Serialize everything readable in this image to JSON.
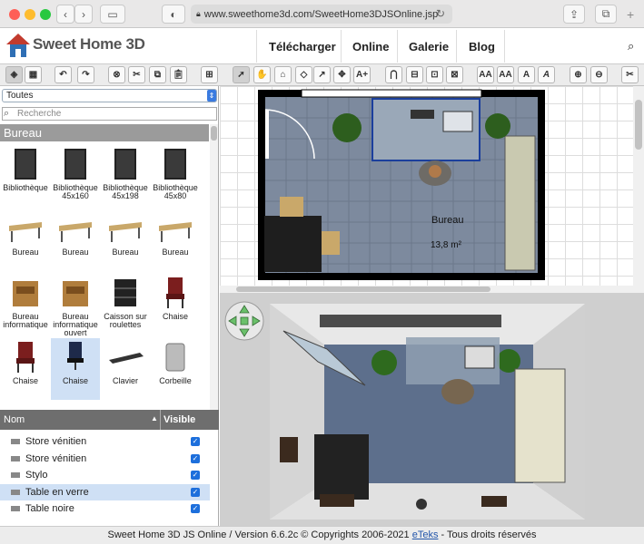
{
  "browser": {
    "url": "www.sweethome3d.com/SweetHome3DJSOnline.jsp"
  },
  "site": {
    "logo": "Sweet Home 3D",
    "nav": [
      "Télécharger",
      "Online",
      "Galerie",
      "Blog"
    ]
  },
  "toolbar": {
    "text_buttons": [
      "A+",
      "AA",
      "AA",
      "A",
      "A"
    ]
  },
  "catalog": {
    "category_select": "Toutes",
    "search_placeholder": "Recherche",
    "group": "Bureau",
    "items": [
      {
        "label": "Bibliothèque",
        "icon": "bookcase-icon"
      },
      {
        "label": "Bibliothèque 45x160",
        "icon": "bookcase-icon"
      },
      {
        "label": "Bibliothèque 45x198",
        "icon": "bookcase-icon"
      },
      {
        "label": "Bibliothèque 45x80",
        "icon": "bookcase-icon"
      },
      {
        "label": "Bureau",
        "icon": "desk-icon"
      },
      {
        "label": "Bureau",
        "icon": "desk-icon"
      },
      {
        "label": "Bureau",
        "icon": "desk-icon"
      },
      {
        "label": "Bureau",
        "icon": "desk-icon"
      },
      {
        "label": "Bureau informatique",
        "icon": "computer-desk-icon"
      },
      {
        "label": "Bureau informatique ouvert",
        "icon": "computer-desk-icon"
      },
      {
        "label": "Caisson sur roulettes",
        "icon": "drawer-unit-icon"
      },
      {
        "label": "Chaise",
        "icon": "chair-icon"
      },
      {
        "label": "Chaise",
        "icon": "chair-icon"
      },
      {
        "label": "Chaise",
        "icon": "office-chair-icon"
      },
      {
        "label": "Clavier",
        "icon": "keyboard-icon"
      },
      {
        "label": "Corbeille",
        "icon": "wastebasket-icon"
      }
    ]
  },
  "furniture_table": {
    "col_name": "Nom",
    "col_visible": "Visible",
    "rows": [
      {
        "name": "Store vénitien",
        "visible": true
      },
      {
        "name": "Store vénitien",
        "visible": true
      },
      {
        "name": "Stylo",
        "visible": true
      },
      {
        "name": "Table en verre",
        "visible": true,
        "selected": true
      },
      {
        "name": "Table noire",
        "visible": true
      }
    ]
  },
  "plan": {
    "room_name": "Bureau",
    "room_area": "13,8 m²"
  },
  "footer": {
    "text": "Sweet Home 3D JS Online / Version 6.6.2c   © Copyrights 2006-2021",
    "link": "eTeks",
    "suffix": " - Tous droits réservés"
  }
}
